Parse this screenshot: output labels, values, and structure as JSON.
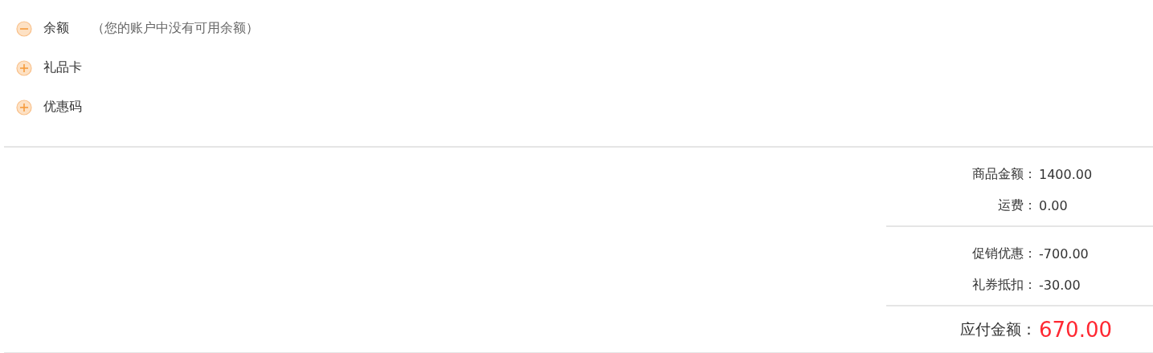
{
  "payment_options": [
    {
      "label": "余额",
      "expanded": true,
      "note": "（您的账户中没有可用余额）"
    },
    {
      "label": "礼品卡",
      "expanded": false
    },
    {
      "label": "优惠码",
      "expanded": false
    }
  ],
  "summary_groups": [
    {
      "rows": [
        {
          "label": "商品金额：",
          "value": "1400.00"
        },
        {
          "label": "运费：",
          "value": "0.00"
        }
      ]
    },
    {
      "rows": [
        {
          "label": "促销优惠：",
          "value": "-700.00"
        },
        {
          "label": "礼券抵扣：",
          "value": "-30.00"
        }
      ]
    }
  ],
  "total": {
    "label": "应付金额：",
    "value": "670.00"
  }
}
